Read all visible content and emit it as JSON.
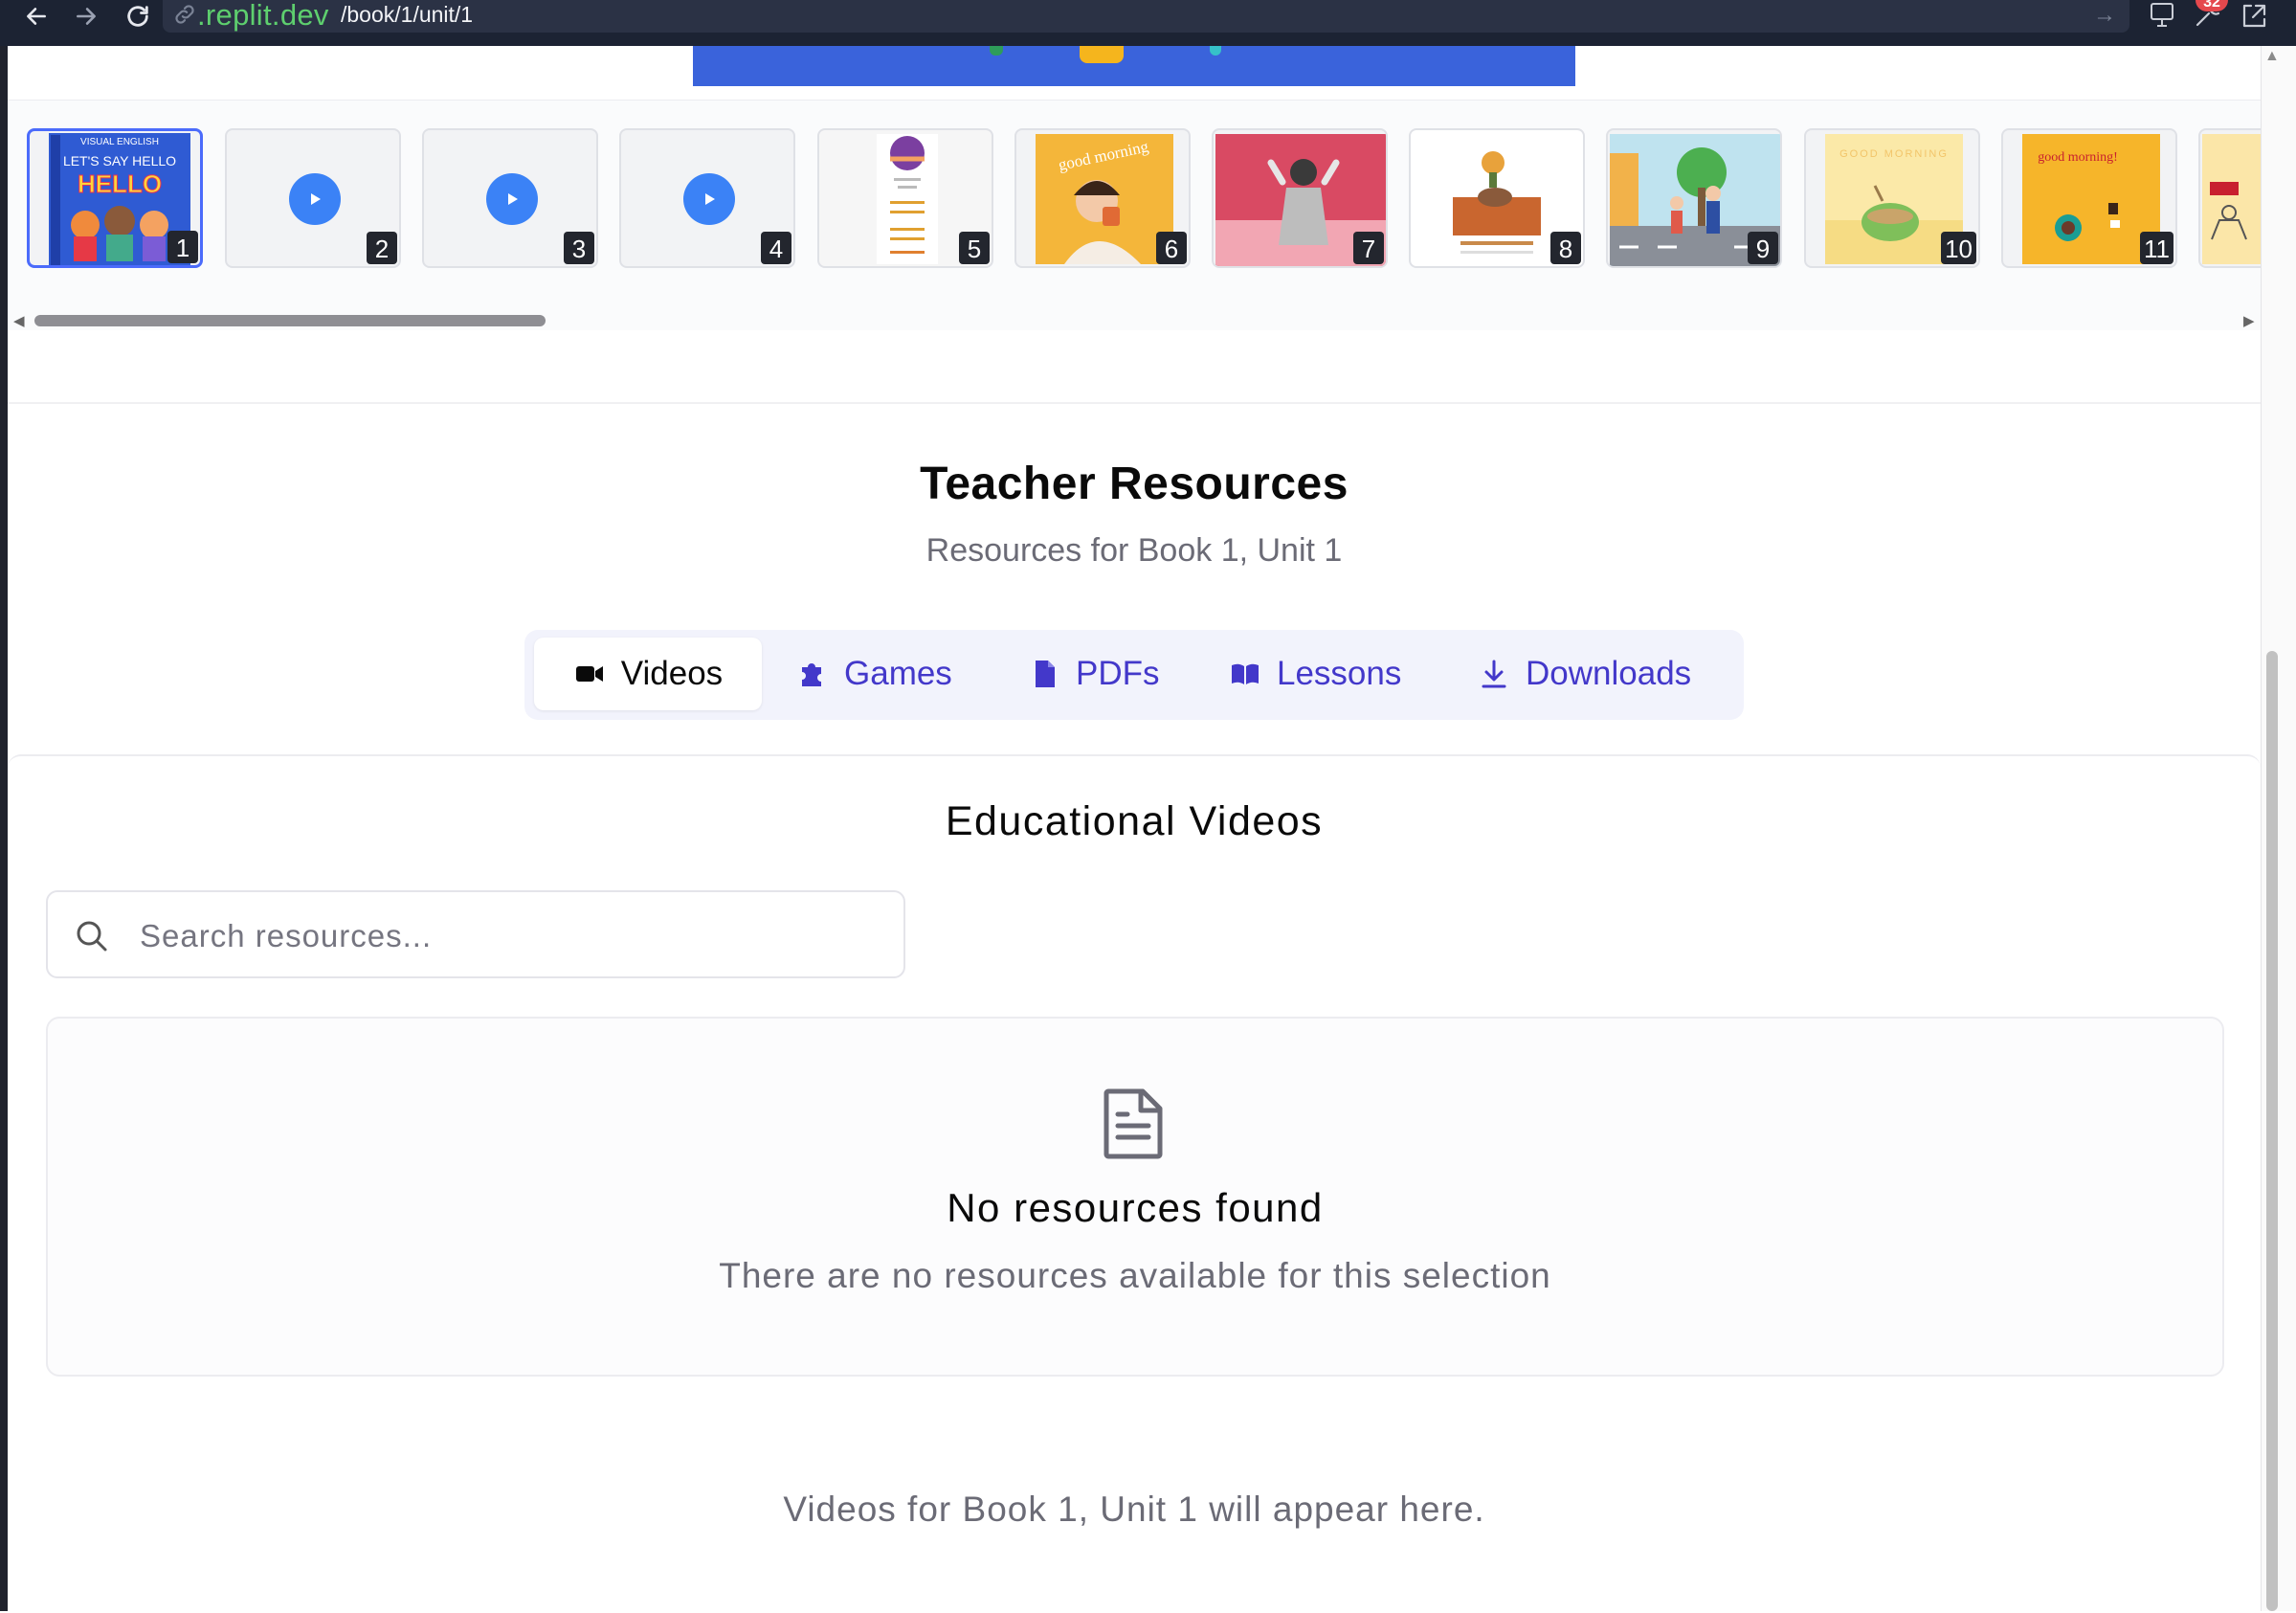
{
  "browser": {
    "url_domain": ".replit.dev",
    "url_path": "/book/1/unit/1",
    "notification_badge": "32"
  },
  "thumbnails": [
    {
      "number": "1",
      "kind": "image",
      "caption_top": "VISUAL ENGLISH",
      "caption": "LET'S SAY HELLO",
      "headline": "HELLO",
      "active": true
    },
    {
      "number": "2",
      "kind": "video"
    },
    {
      "number": "3",
      "kind": "video"
    },
    {
      "number": "4",
      "kind": "video"
    },
    {
      "number": "5",
      "kind": "image"
    },
    {
      "number": "6",
      "kind": "image",
      "caption": "good morning"
    },
    {
      "number": "7",
      "kind": "image"
    },
    {
      "number": "8",
      "kind": "image"
    },
    {
      "number": "9",
      "kind": "image"
    },
    {
      "number": "10",
      "kind": "image",
      "caption": "GOOD MORNING"
    },
    {
      "number": "11",
      "kind": "image",
      "caption": "good morning!"
    },
    {
      "number": "",
      "kind": "image"
    }
  ],
  "teacher_resources": {
    "title": "Teacher Resources",
    "subtitle": "Resources for Book 1, Unit 1",
    "tabs": [
      {
        "label": "Videos",
        "icon": "video-camera-icon",
        "active": true
      },
      {
        "label": "Games",
        "icon": "puzzle-icon",
        "active": false
      },
      {
        "label": "PDFs",
        "icon": "file-icon",
        "active": false
      },
      {
        "label": "Lessons",
        "icon": "book-open-icon",
        "active": false
      },
      {
        "label": "Downloads",
        "icon": "download-icon",
        "active": false
      }
    ],
    "section_title": "Educational Videos",
    "search": {
      "placeholder": "Search resources...",
      "value": ""
    },
    "empty_state": {
      "title": "No resources found",
      "description": "There are no resources available for this selection"
    },
    "footer_note": "Videos for Book 1, Unit 1 will appear here."
  },
  "colors": {
    "accent": "#4338ca",
    "play_button": "#3b82f6",
    "banner": "#3a63db",
    "url_domain": "#5ecf6e"
  }
}
